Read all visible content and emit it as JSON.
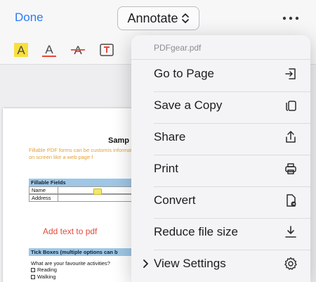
{
  "nav": {
    "done_label": "Done",
    "mode_label": "Annotate"
  },
  "colors": {
    "accent": "#2b7cf6",
    "highlight": "#f7e03c",
    "underline_red": "#e5483c"
  },
  "toolbar": {
    "tools": [
      "highlight-text-icon",
      "underline-text-icon",
      "strikethrough-text-icon",
      "text-box-icon"
    ]
  },
  "pdf": {
    "title": "Samp",
    "intro": "Fillable PDF forms can be customis information on screen like a web page f",
    "fillable_header": "Fillable Fields",
    "rows": [
      "Name",
      "Address"
    ],
    "add_text": "Add text to pdf",
    "tick_header": "Tick Boxes (multiple options can b",
    "question": "What are your favourite activities?",
    "options": [
      "Reading",
      "Walking"
    ]
  },
  "menu": {
    "filename": "PDFgear.pdf",
    "items": [
      {
        "label": "Go to Page",
        "icon": "go-to-page-icon"
      },
      {
        "label": "Save a Copy",
        "icon": "copy-icon"
      },
      {
        "label": "Share",
        "icon": "share-icon"
      },
      {
        "label": "Print",
        "icon": "print-icon"
      },
      {
        "label": "Convert",
        "icon": "convert-icon"
      },
      {
        "label": "Reduce file size",
        "icon": "download-icon"
      },
      {
        "label": "View Settings",
        "icon": "settings-gear-icon"
      }
    ]
  }
}
